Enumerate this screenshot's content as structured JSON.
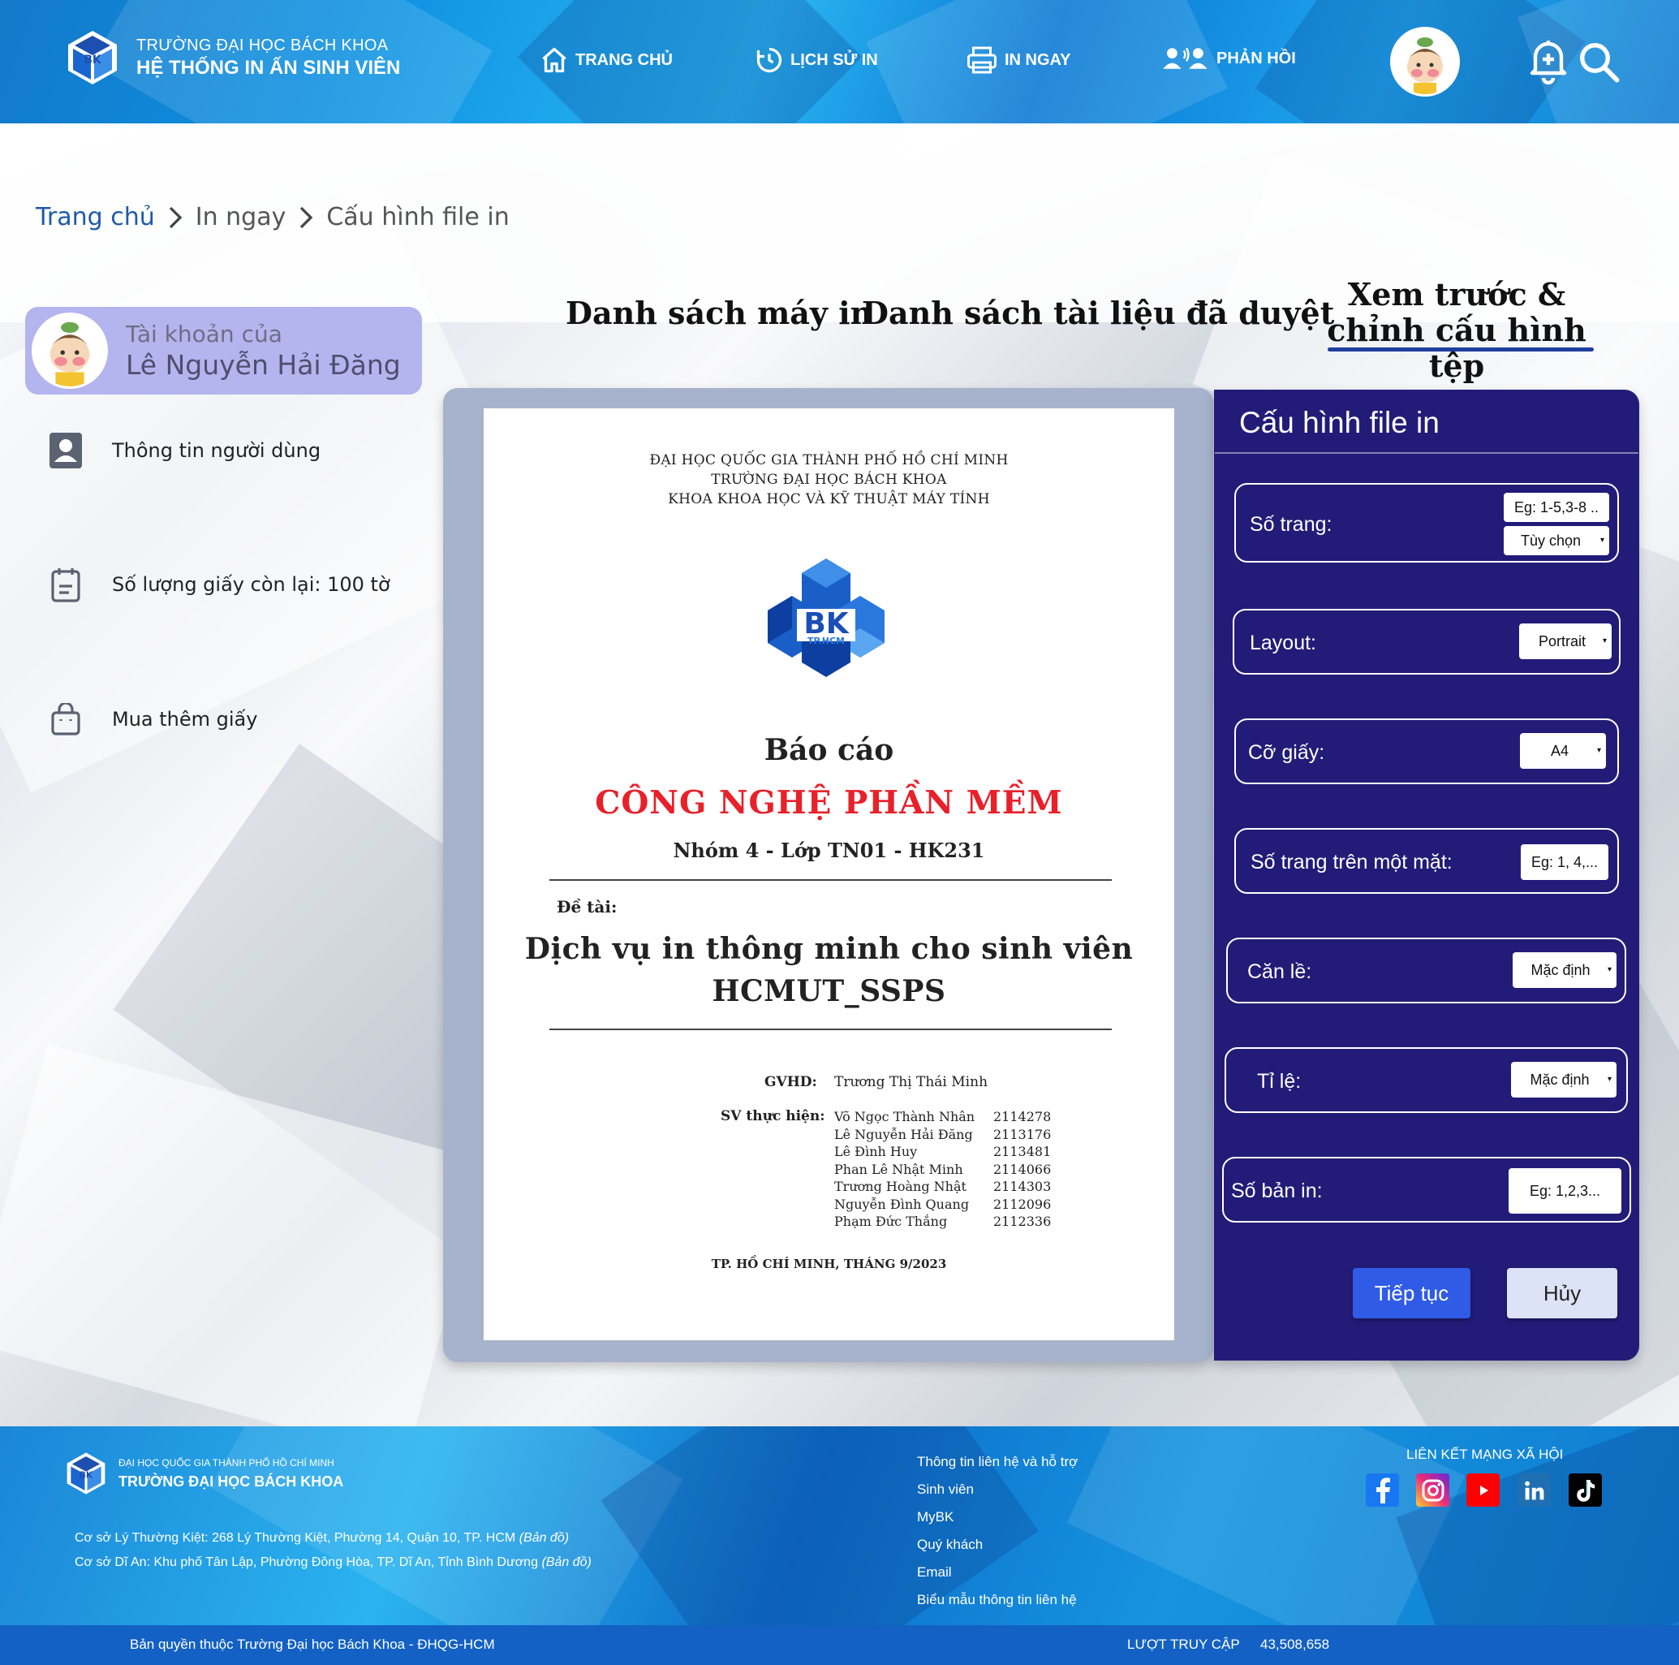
{
  "header": {
    "school_line1": "TRƯỜNG ĐẠI HỌC BÁCH KHOA",
    "school_line2": "HỆ THỐNG IN ẤN SINH VIÊN",
    "logo_text": "BK",
    "nav": [
      {
        "label": "TRANG CHỦ",
        "icon": "home-icon"
      },
      {
        "label": "LỊCH SỬ IN",
        "icon": "history-icon"
      },
      {
        "label": "IN NGAY",
        "icon": "printer-icon"
      },
      {
        "label": "PHẢN HỒI",
        "icon": "feedback-icon"
      }
    ]
  },
  "breadcrumb": {
    "items": [
      "Trang chủ",
      "In ngay",
      "Cấu hình file in"
    ]
  },
  "sidebar": {
    "account_label": "Tài khoản của",
    "account_name": "Lê Nguyễn Hải Đăng",
    "items": [
      {
        "label": "Thông tin người dùng",
        "icon": "user-card-icon"
      },
      {
        "label": "Số lượng giấy còn lại: 100 tờ",
        "icon": "calendar-icon"
      },
      {
        "label": "Mua thêm giấy",
        "icon": "shopping-bag-icon"
      }
    ]
  },
  "tabs": {
    "printers": "Danh sách máy in",
    "approved_docs": "Danh sách tài liệu đã duyệt",
    "preview_line1": "Xem trước &",
    "preview_line2": "chỉnh cấu hình tệp"
  },
  "document": {
    "header_line1": "ĐẠI HỌC QUỐC GIA THÀNH PHỐ HỒ CHÍ MINH",
    "header_line2": "TRƯỜNG ĐẠI HỌC BÁCH KHOA",
    "header_line3": "KHOA KHOA HỌC VÀ KỸ THUẬT MÁY TÍNH",
    "logo_text": "BK",
    "logo_sub": "TP.HCM",
    "report": "Báo cáo",
    "title": "CÔNG NGHỆ PHẦN MỀM",
    "group": "Nhóm 4 - Lớp TN01 - HK231",
    "topic_label": "Đề tài:",
    "topic_line1": "Dịch vụ in thông minh cho sinh viên",
    "topic_line2": "HCMUT_SSPS",
    "gvhd_label": "GVHD:",
    "gvhd_name": "Trương Thị Thái Minh",
    "sv_label": "SV thực hiện:",
    "members": [
      {
        "name": "Võ Ngọc Thành Nhân",
        "id": "2114278"
      },
      {
        "name": "Lê Nguyễn Hải Đăng",
        "id": "2113176"
      },
      {
        "name": "Lê Đình Huy",
        "id": "2113481"
      },
      {
        "name": "Phan Lê Nhật Minh",
        "id": "2114066"
      },
      {
        "name": "Trương Hoàng Nhật",
        "id": "2114303"
      },
      {
        "name": "Nguyễn Đình Quang",
        "id": "2112096"
      },
      {
        "name": "Phạm Đức Thắng",
        "id": "2112336"
      }
    ],
    "footer": "TP. HỒ CHÍ MINH, THÁNG 9/2023"
  },
  "config": {
    "title": "Cấu hình file in",
    "pages_label": "Số trang:",
    "pages_placeholder": "Eg: 1-5,3-8 ..",
    "pages_option": "Tùy chọn",
    "layout_label": "Layout:",
    "layout_value": "Portrait",
    "paper_label": "Cỡ giấy:",
    "paper_value": "A4",
    "pps_label": "Số trang trên một mặt:",
    "pps_placeholder": "Eg: 1, 4,...",
    "margin_label": "Căn lề:",
    "margin_value": "Mặc định",
    "scale_label": "Tỉ lệ:",
    "scale_value": "Mặc định",
    "copies_label": "Số bản in:",
    "copies_placeholder": "Eg: 1,2,3...",
    "continue_label": "Tiếp tục",
    "cancel_label": "Hủy"
  },
  "footer": {
    "uni_line1": "ĐẠI HỌC QUỐC GIA THÀNH PHỐ HỒ CHÍ MINH",
    "uni_line2": "TRƯỜNG ĐẠI HỌC BÁCH KHOA",
    "addr1": "Cơ sở Lý Thường Kiệt: 268 Lý Thường Kiệt, Phường 14, Quận 10, TP. HCM",
    "addr2": "Cơ sở Dĩ An: Khu phố Tân Lập, Phường Đông Hòa, TP. Dĩ An, Tỉnh Bình Dương",
    "map_link": "(Bản đồ)",
    "links": [
      "Thông tin liên hệ và hỗ trợ",
      "Sinh viên",
      "MyBK",
      "Quý khách",
      "Email",
      "Biểu mẫu thông tin liên hệ"
    ],
    "social_title": "LIÊN KẾT MẠNG XÃ HỘI",
    "social": [
      "facebook-icon",
      "instagram-icon",
      "youtube-icon",
      "linkedin-icon",
      "tiktok-icon"
    ],
    "copyright": "Bản quyền thuộc Trường Đại học Bách Khoa - ĐHQG-HCM",
    "visits_label": "LƯỢT TRUY CẬP",
    "visits_value": "43,508,658"
  },
  "colors": {
    "header_blue": "#0c8fe0",
    "panel_navy": "#221c78",
    "account_card": "#b4b5ee",
    "continue_btn": "#2f5be6",
    "doc_title_red": "#e8202a",
    "link_blue": "#1e5ba8"
  }
}
